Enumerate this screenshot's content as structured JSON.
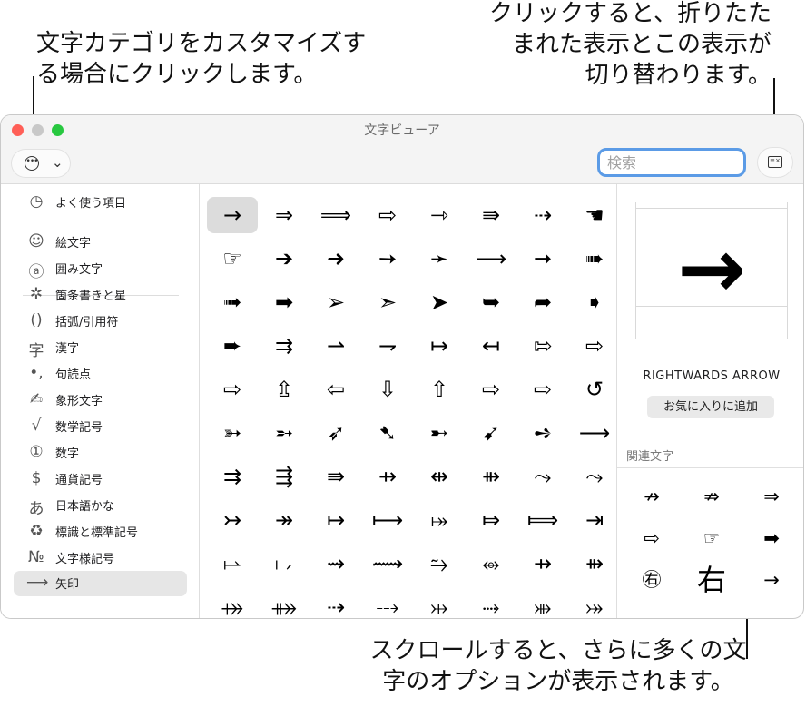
{
  "callouts": {
    "left": "文字カテゴリをカスタマイズす\nる場合にクリックします。",
    "right": "クリックすると、折りたた\nまれた表示とこの表示が\n切り替わります。",
    "bottom": "スクロールすると、さらに多くの文\n字のオプションが表示されます。"
  },
  "window": {
    "title": "文字ビューア"
  },
  "toolbar": {
    "more_icon": "ellipsis-circle-icon",
    "chevron_icon": "chevron-down-icon",
    "collapse_icon": "collapse-view-icon"
  },
  "search": {
    "placeholder": "検索",
    "value": ""
  },
  "sidebar": {
    "items": [
      {
        "icon": "◷",
        "label": "よく使う項目"
      },
      {
        "icon": "☺",
        "label": "絵文字"
      },
      {
        "icon": "ⓐ",
        "label": "囲み文字"
      },
      {
        "icon": "✲",
        "label": "箇条書きと星"
      },
      {
        "icon": "()",
        "label": "括弧/引用符"
      },
      {
        "icon": "字",
        "label": "漢字"
      },
      {
        "icon": "•,",
        "label": "句読点"
      },
      {
        "icon": "✍",
        "label": "象形文字"
      },
      {
        "icon": "√",
        "label": "数学記号"
      },
      {
        "icon": "①",
        "label": "数字"
      },
      {
        "icon": "$",
        "label": "通貨記号"
      },
      {
        "icon": "あ",
        "label": "日本語かな"
      },
      {
        "icon": "♻",
        "label": "標識と標準記号"
      },
      {
        "icon": "№",
        "label": "文字様記号"
      },
      {
        "icon": "⟶",
        "label": "矢印"
      }
    ],
    "selected_index": 14
  },
  "grid": {
    "rows": [
      [
        "→",
        "⇒",
        "⟹",
        "⇨",
        "⇾",
        "⇛",
        "⇢",
        "☚"
      ],
      [
        "☞",
        "➔",
        "➜",
        "➙",
        "➛",
        "⟶",
        "➞",
        "➠"
      ],
      [
        "➟",
        "➡",
        "➢",
        "➣",
        "➤",
        "➥",
        "➦",
        "➧"
      ],
      [
        "➨",
        "⇉",
        "⇀",
        "⇁",
        "↦",
        "↤",
        "⇰",
        "⇨"
      ],
      [
        "⇨",
        "⇫",
        "⇦",
        "⇩",
        "⇧",
        "⇨",
        "⇨",
        "↺"
      ],
      [
        "➳",
        "➵",
        "➶",
        "➷",
        "➸",
        "➹",
        "➺",
        "⟶"
      ],
      [
        "⇉",
        "⇶",
        "⇛",
        "⇸",
        "⇹",
        "⇻",
        "⤳",
        "⤳"
      ],
      [
        "↣",
        "↠",
        "↦",
        "⟼",
        "⤅",
        "⤇",
        "⟾",
        "⇥"
      ],
      [
        "⥛",
        "⥟",
        "⇝",
        "⟿",
        "⥲",
        "⥈",
        "⇸",
        "⇻"
      ],
      [
        "⤀",
        "⤁",
        "⇢",
        "⤏",
        "⤔",
        "⤑",
        "⤕",
        "⤖"
      ]
    ],
    "selected": "→"
  },
  "detail": {
    "glyph": "→",
    "name": "RIGHTWARDS ARROW",
    "favorite_button": "お気に入りに追加",
    "related_title": "関連文字",
    "related": [
      "↛",
      "⇏",
      "⇒",
      "⇨",
      "☞",
      "➡",
      "㊨",
      "右",
      "→"
    ]
  }
}
